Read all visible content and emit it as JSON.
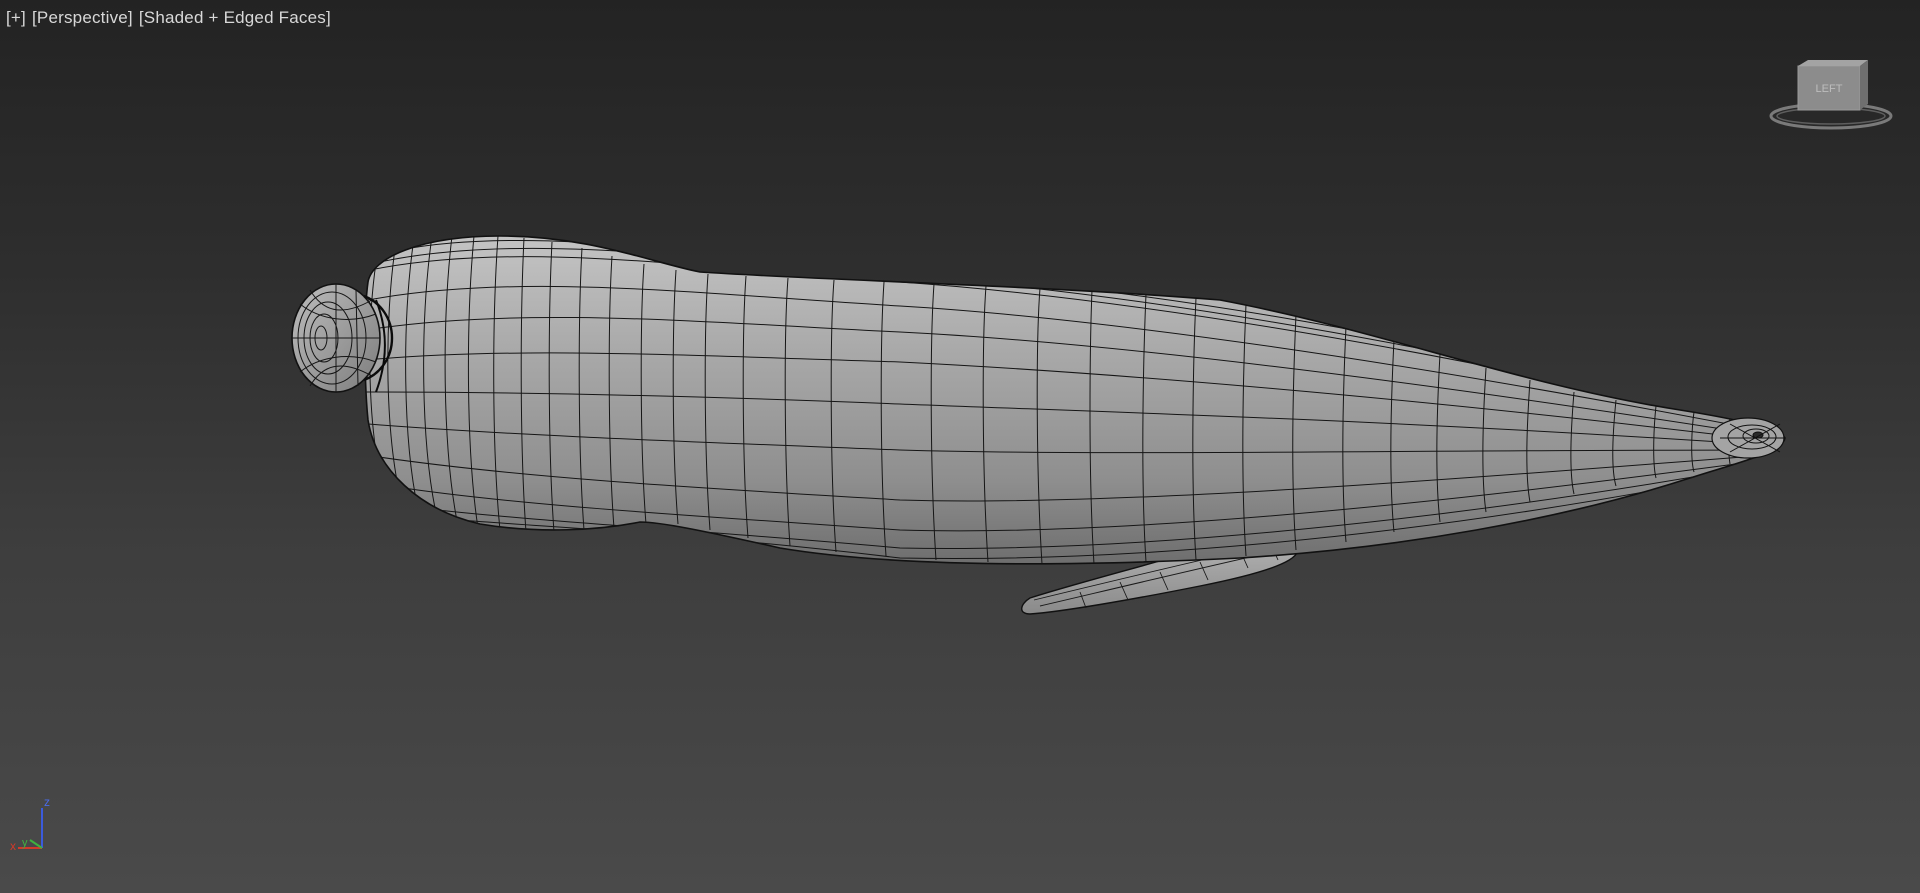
{
  "viewport": {
    "label_plus": "[+]",
    "label_view": "[Perspective]",
    "label_shading": "[Shaded + Edged Faces]",
    "background_top": "#232323",
    "background_bottom": "#4a4a4a"
  },
  "viewcube": {
    "face_label": "LEFT",
    "icon": "viewcube-icon"
  },
  "axis_tripod": {
    "z_label": "z",
    "x_label": "x",
    "y_label": "y",
    "x_color": "#d23a2a",
    "y_color": "#3fb13f",
    "z_color": "#3b5bdc"
  },
  "model": {
    "name": "fish-mesh",
    "shading": "Shaded + Edged Faces",
    "surface_color": "#9c9c9c",
    "edge_color": "#141414"
  }
}
